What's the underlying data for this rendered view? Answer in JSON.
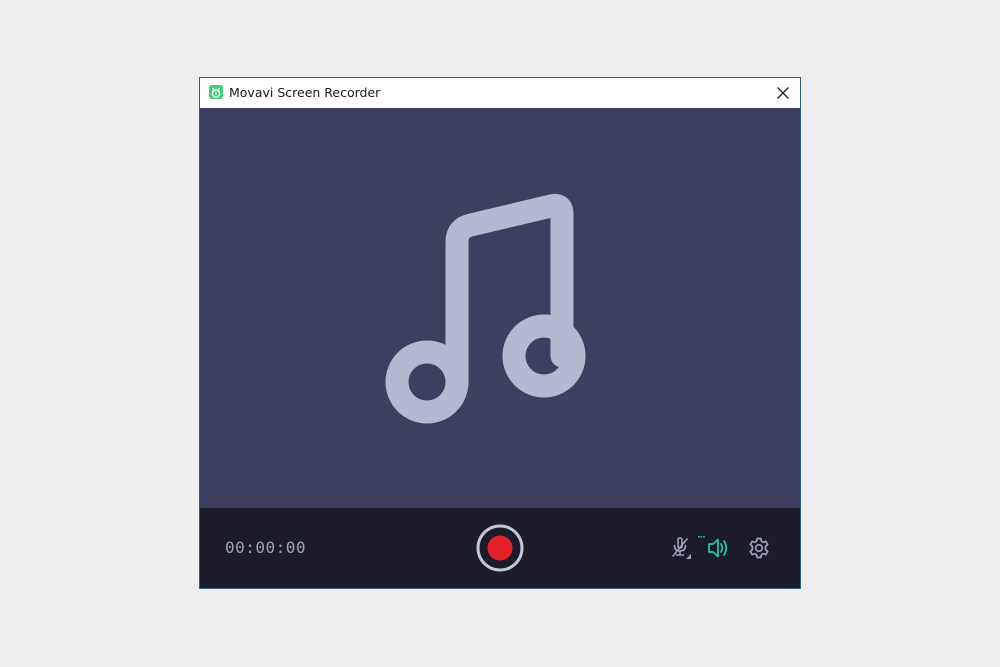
{
  "window": {
    "title": "Movavi Screen Recorder"
  },
  "icons": {
    "app": "movavi-app-icon",
    "close": "close-icon",
    "preview": "music-note-icon",
    "record": "record-icon",
    "microphone": "microphone-muted-icon",
    "speaker": "speaker-icon",
    "settings": "gear-icon"
  },
  "controls": {
    "timer": "00:00:00"
  },
  "colors": {
    "preview_bg": "#3c3f60",
    "control_bar_bg": "#1b1c27",
    "record_dot": "#e4202a",
    "speaker_active": "#2bc4a0",
    "app_icon": "#3ecf7a"
  }
}
